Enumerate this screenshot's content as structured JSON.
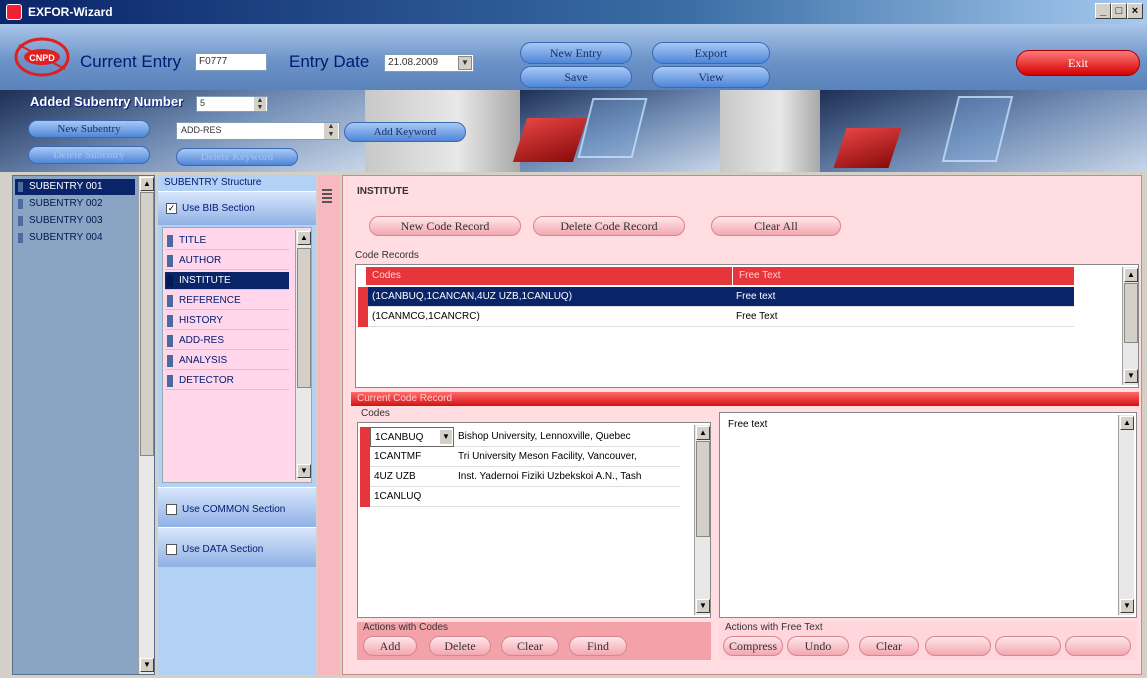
{
  "window": {
    "title": "EXFOR-Wizard",
    "min_glyph": "_",
    "max_glyph": "□",
    "close_glyph": "×"
  },
  "header": {
    "logo_text": "CNPD",
    "current_entry_label": "Current Entry",
    "current_entry_value": "F0777",
    "entry_date_label": "Entry Date",
    "entry_date_value": "21.08.2009",
    "new_entry_label": "New Entry",
    "save_label": "Save",
    "export_label": "Export",
    "view_label": "View",
    "exit_label": "Exit"
  },
  "banner": {
    "added_subentry_label": "Added Subentry Number",
    "added_subentry_value": "5",
    "new_subentry_label": "New Subentry",
    "delete_subentry_label": "Delete Subentry",
    "keyword_value": "ADD-RES",
    "add_keyword_label": "Add Keyword",
    "delete_keyword_label": "Delete Keyword"
  },
  "subentries": [
    "SUBENTRY 001",
    "SUBENTRY 002",
    "SUBENTRY 003",
    "SUBENTRY 004"
  ],
  "structure": {
    "title": "SUBENTRY Structure",
    "use_bib_label": "Use BIB Section",
    "use_bib_checked": "✓",
    "keywords": [
      "TITLE",
      "AUTHOR",
      "INSTITUTE",
      "REFERENCE",
      "HISTORY",
      "ADD-RES",
      "ANALYSIS",
      "DETECTOR"
    ],
    "use_common_label": "Use COMMON Section",
    "use_data_label": "Use DATA Section"
  },
  "main": {
    "section_title": "INSTITUTE",
    "new_code_record_label": "New Code Record",
    "delete_code_record_label": "Delete Code Record",
    "clear_all_label": "Clear All",
    "code_records_label": "Code Records",
    "code_records_headers": [
      "Codes",
      "Free Text"
    ],
    "code_records": [
      {
        "codes": "(1CANBUQ,1CANCAN,4UZ UZB,1CANLUQ)",
        "free_text": "Free text"
      },
      {
        "codes": "(1CANMCG,1CANCRC)",
        "free_text": "Free Text"
      }
    ],
    "current_record_label": "Current Code Record",
    "codes_label": "Codes",
    "codes": [
      {
        "code": "1CANBUQ",
        "desc": "Bishop University, Lennoxville, Quebec"
      },
      {
        "code": "1CANTMF",
        "desc": "Tri University Meson Facility, Vancouver,"
      },
      {
        "code": "4UZ UZB",
        "desc": "Inst. Yadernoi Fiziki Uzbekskoi A.N., Tash"
      },
      {
        "code": "1CANLUQ",
        "desc": ""
      }
    ],
    "free_text_value": "Free text",
    "actions_codes_label": "Actions with Codes",
    "add_label": "Add",
    "delete_label": "Delete",
    "clear_label": "Clear",
    "find_label": "Find",
    "actions_free_label": "Actions with Free Text",
    "compress_label": "Compress",
    "undo_label": "Undo",
    "clear_free_label": "Clear"
  },
  "colors": {
    "title_bar": "#0a246a",
    "grid_header": "#e6363c",
    "selection": "#0a246a",
    "pink_panel": "#ffdde0",
    "blue_panel": "#b3d0f5"
  }
}
